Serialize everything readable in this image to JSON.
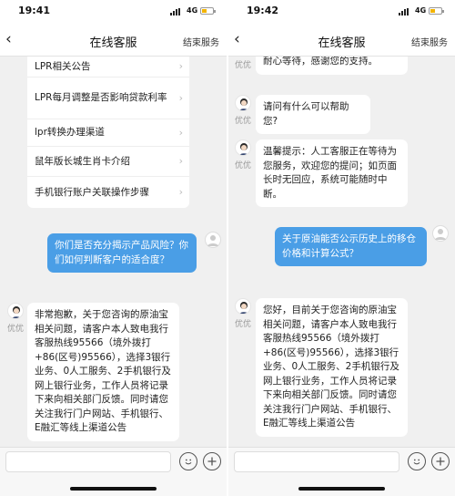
{
  "left": {
    "status": {
      "time": "19:41",
      "network": "4G"
    },
    "nav": {
      "back": "‹",
      "title": "在线客服",
      "end_service": "结束服务"
    },
    "faq_items": [
      "LPR相关公告",
      "LPR每月调整是否影响贷款利率",
      "lpr转换办理渠道",
      "鼠年版长城生肖卡介绍",
      "手机银行账户关联操作步骤"
    ],
    "user_message": "你们是否充分揭示产品风险？你们如何判断客户的适合度？",
    "agent_name": "优优",
    "agent_reply": "非常抱歉，关于您咨询的原油宝相关问题，请客户本人致电我行客服热线95566（境外拨打+86(区号)95566），选择3银行业务、0人工服务、2手机银行及网上银行业务，工作人员将记录下来向相关部门反馈。同时请您关注我行门户网站、手机银行、E融汇等线上渠道公告"
  },
  "right": {
    "status": {
      "time": "19:42",
      "network": "4G"
    },
    "nav": {
      "back": "‹",
      "title": "在线客服",
      "end_service": "结束服务"
    },
    "agent_name": "优优",
    "partial_message": "耐心等待，感谢您的支持。",
    "greeting": "请问有什么可以帮助您?",
    "notice": "温馨提示：人工客服正在等待为您服务，欢迎您的提问；如页面长时无回应，系统可能随时中断。",
    "user_message": "关于原油能否公示历史上的移仓价格和计算公式？",
    "agent_reply": "您好，目前关于您咨询的原油宝相关问题，请客户本人致电我行客服热线95566（境外拨打+86(区号)95566），选择3银行业务、0人工服务、2手机银行及网上银行业务，工作人员将记录下来向相关部门反馈。同时请您关注我行门户网站、手机银行、E融汇等线上渠道公告"
  },
  "icons": {
    "back": "chevron-left-icon",
    "faq_arrow": "chevron-right-icon",
    "emoji": "smiley-icon",
    "add": "plus-circle-icon",
    "avatar": "agent-avatar-icon"
  },
  "colors": {
    "user_bubble": "#4a9ee6",
    "agent_bubble": "#ffffff",
    "background": "#f0f0f0",
    "battery": "#f3b400"
  }
}
